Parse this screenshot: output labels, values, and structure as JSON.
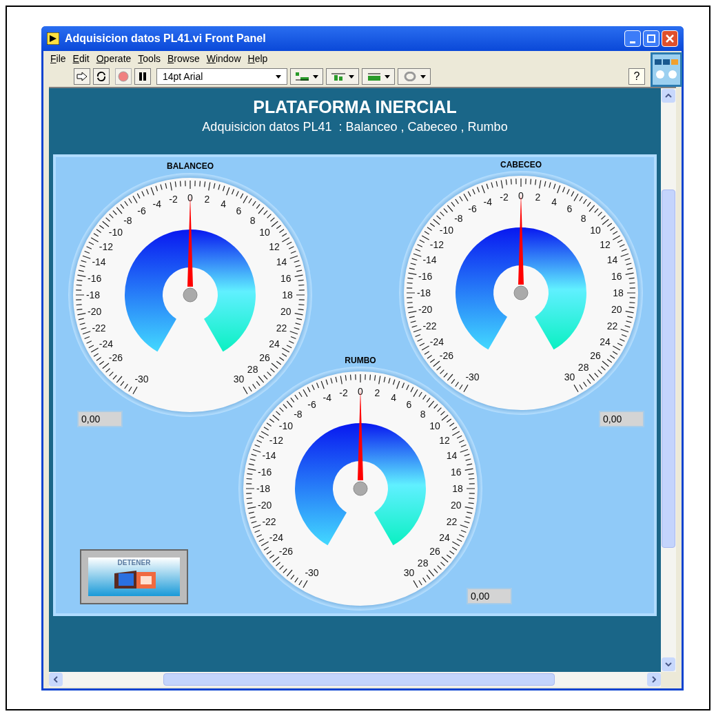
{
  "window": {
    "title": "Adquisicion datos PL41.vi Front Panel"
  },
  "menu": [
    "File",
    "Edit",
    "Operate",
    "Tools",
    "Browse",
    "Window",
    "Help"
  ],
  "toolbar": {
    "font": "14pt Arial",
    "help": "?"
  },
  "panel": {
    "title": "PLATAFORMA INERCIAL",
    "subtitle": "Adquisicion datos PL41  : Balanceo , Cabeceo , Rumbo"
  },
  "gauges": [
    {
      "label": "BALANCEO",
      "level": 0.5,
      "reading": "0,00",
      "scale": [
        "-4",
        "-2",
        "0",
        "2",
        "4",
        "-6",
        "6",
        "-8",
        "8",
        "-10",
        "10",
        "-12",
        "12",
        "-14",
        "14",
        "-16",
        "16",
        "-18",
        "18",
        "-20",
        "20",
        "-22",
        "22",
        "-24",
        "24",
        "-26",
        "26",
        "28",
        "-30",
        "30"
      ]
    },
    {
      "label": "CABECEO",
      "level": 0.5,
      "reading": "0,00",
      "scale": [
        "-4",
        "-2",
        "0",
        "2",
        "4",
        "-6",
        "6",
        "-8",
        "8",
        "-10",
        "10",
        "-12",
        "12",
        "-14",
        "14",
        "-16",
        "16",
        "-18",
        "18",
        "-20",
        "20",
        "-22",
        "22",
        "-24",
        "24",
        "-26",
        "26",
        "28",
        "-30",
        "30"
      ]
    },
    {
      "label": "RUMBO",
      "level": 0.5,
      "reading": "0,00",
      "scale": [
        "-4",
        "-2",
        "0",
        "2",
        "4",
        "-6",
        "6",
        "-8",
        "8",
        "-10",
        "10",
        "-12",
        "12",
        "-14",
        "14",
        "-16",
        "16",
        "-18",
        "18",
        "-20",
        "20",
        "-22",
        "22",
        "-24",
        "24",
        "-26",
        "26",
        "28",
        "-30",
        "30"
      ]
    }
  ],
  "stop_button": {
    "label": "DETENER"
  }
}
